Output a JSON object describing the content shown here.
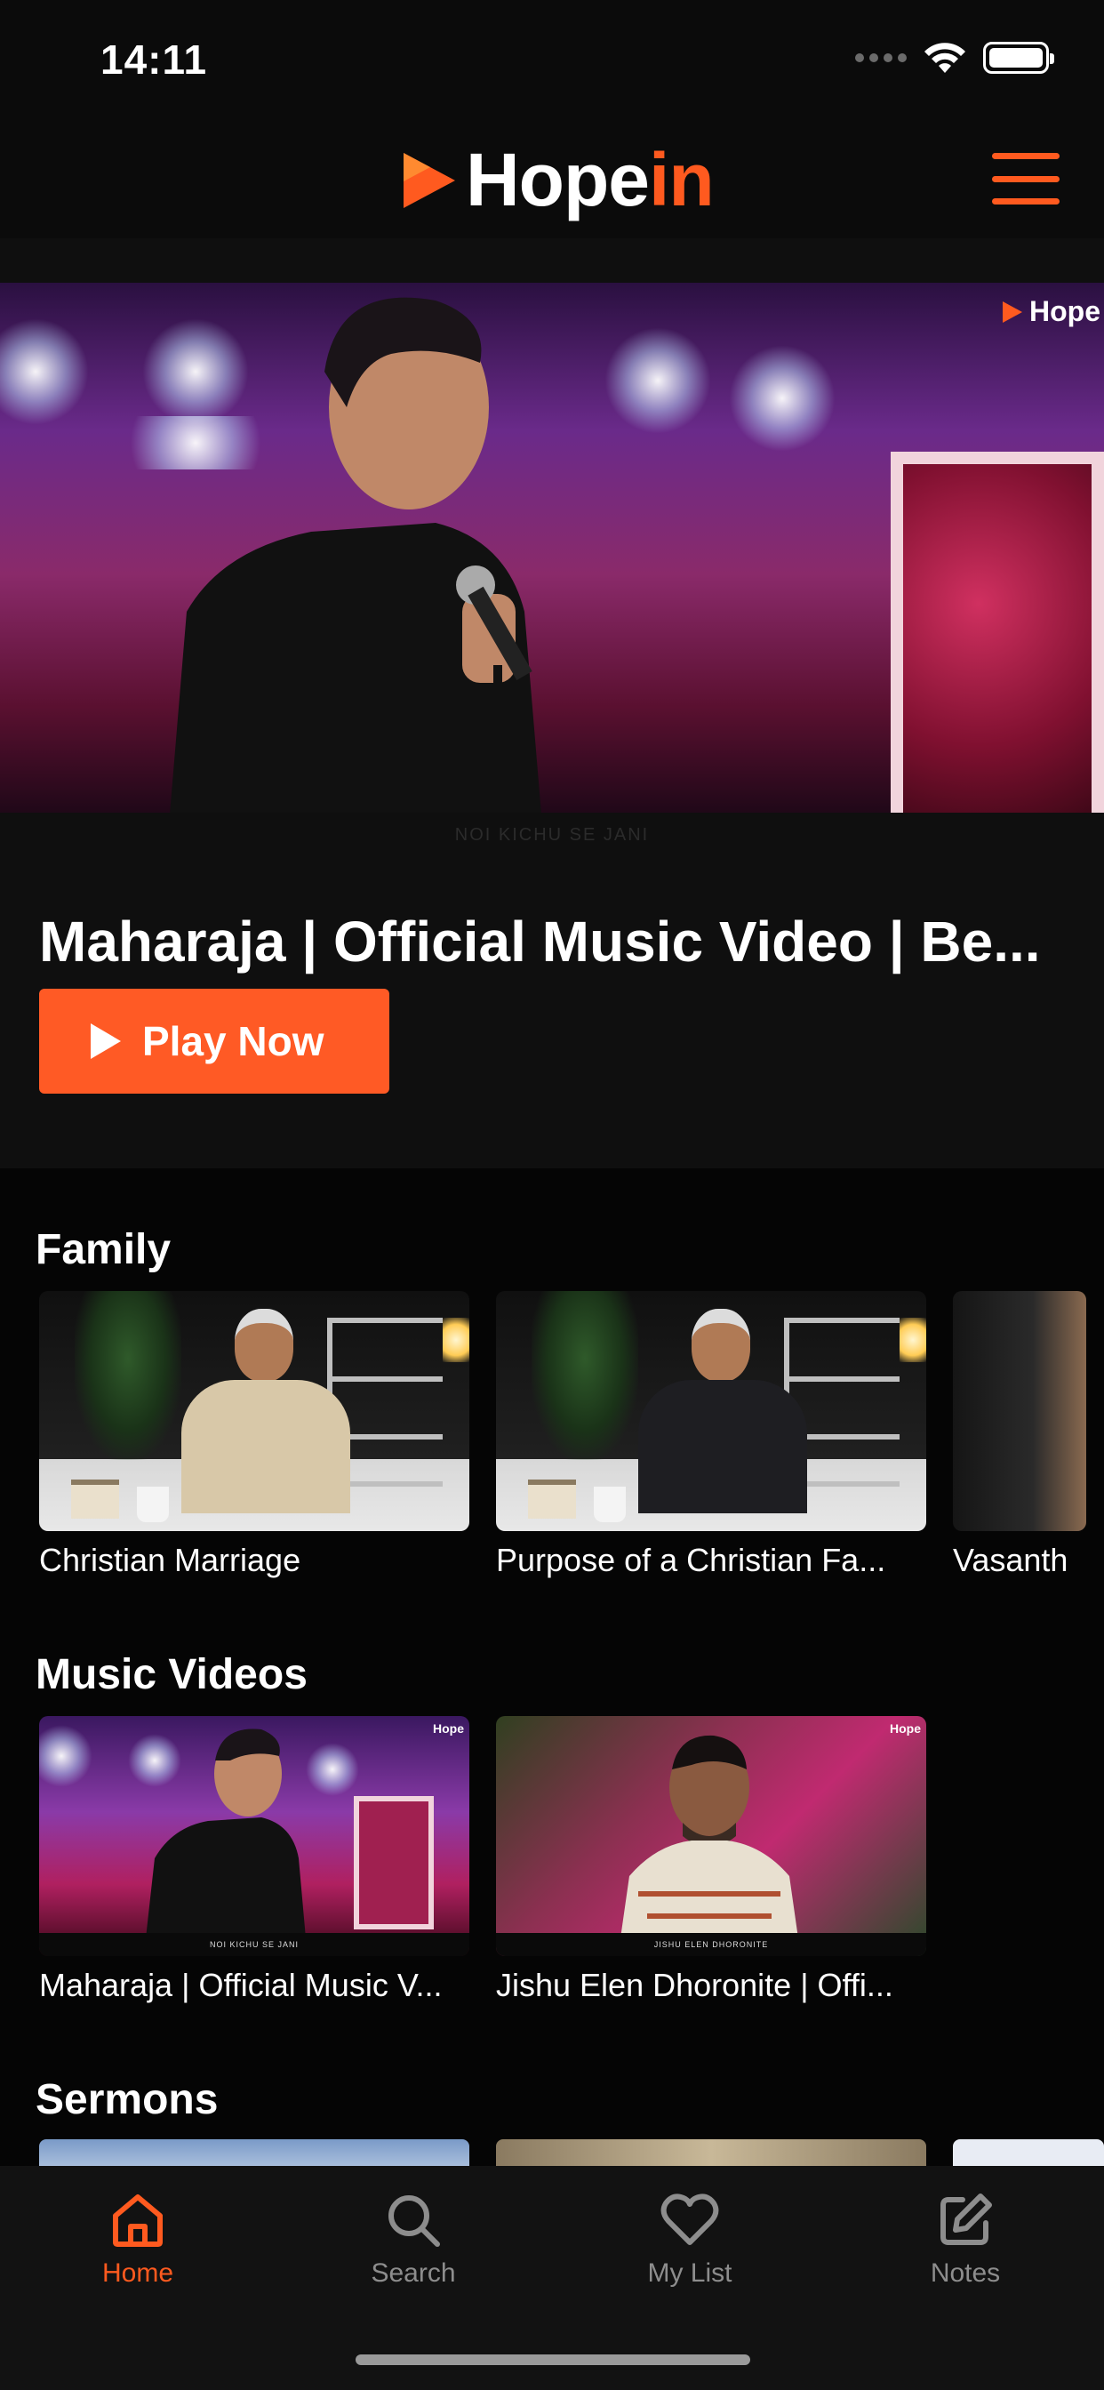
{
  "status_bar": {
    "time": "14:11"
  },
  "header": {
    "logo_part1": "Hope",
    "logo_part2": "in",
    "menu_icon": "hamburger-menu-icon",
    "brand_color": "#ff5a1f"
  },
  "hero": {
    "watermark": "Hope",
    "caption": "NOI KICHU SE JANI",
    "title": "Maharaja | Official Music Video | Be...",
    "play_label": "Play Now",
    "play_color": "#ff5a25"
  },
  "sections": {
    "family": {
      "title": "Family",
      "items": [
        {
          "title": "Christian Marriage"
        },
        {
          "title": "Purpose of a Christian Fa..."
        },
        {
          "title": "Vasanth"
        }
      ]
    },
    "music": {
      "title": "Music Videos",
      "items": [
        {
          "title": "Maharaja | Official Music V...",
          "thumb_label": "NOI KICHU SE JANI",
          "watermark": "Hope"
        },
        {
          "title": "Jishu Elen Dhoronite | Offi...",
          "thumb_label": "JISHU ELEN DHORONITE",
          "watermark": "Hope"
        }
      ]
    },
    "sermons": {
      "title": "Sermons"
    }
  },
  "tab_bar": {
    "tabs": [
      {
        "label": "Home",
        "icon": "home-icon",
        "active": true
      },
      {
        "label": "Search",
        "icon": "search-icon",
        "active": false
      },
      {
        "label": "My List",
        "icon": "heart-icon",
        "active": false
      },
      {
        "label": "Notes",
        "icon": "edit-note-icon",
        "active": false
      }
    ]
  }
}
